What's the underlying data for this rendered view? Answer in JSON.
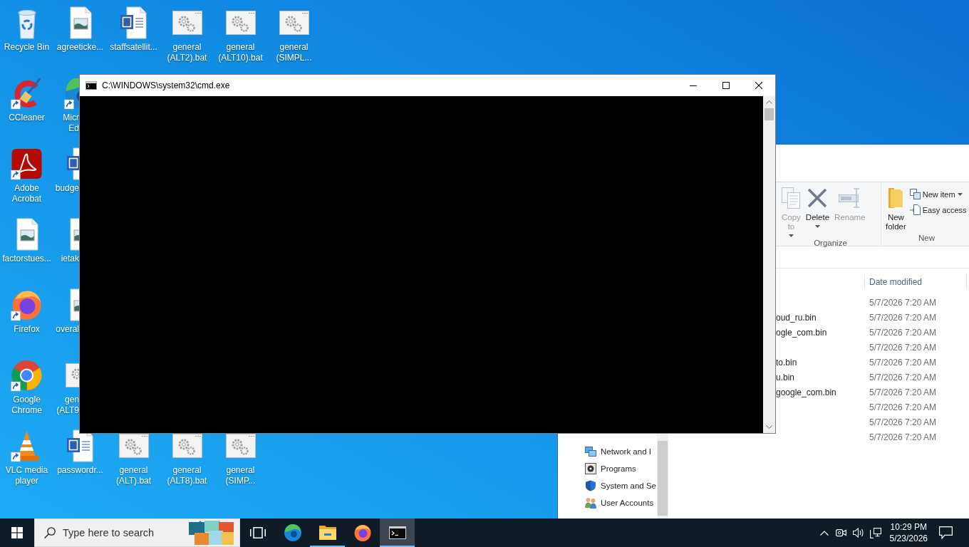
{
  "desktop": {
    "icon_columns": [
      [
        {
          "label": "Recycle Bin",
          "kind": "recycle",
          "shortcut": false,
          "covered": false
        },
        {
          "label": "CCleaner",
          "kind": "ccleaner",
          "shortcut": true,
          "covered": false
        },
        {
          "label": "Adobe Acrobat",
          "kind": "acrobat",
          "shortcut": true,
          "covered": false
        },
        {
          "label": "factorstues...",
          "kind": "image",
          "shortcut": false,
          "covered": false
        },
        {
          "label": "Firefox",
          "kind": "firefox",
          "shortcut": true,
          "covered": false
        },
        {
          "label": "Google Chrome",
          "kind": "chrome",
          "shortcut": true,
          "covered": false
        },
        {
          "label": "VLC media player",
          "kind": "vlc",
          "shortcut": true,
          "covered": false
        }
      ],
      [
        {
          "label": "agreeticke...",
          "kind": "image",
          "shortcut": false,
          "covered": false
        },
        {
          "label": "Micr Ed",
          "kind": "edge",
          "shortcut": true,
          "covered": true
        },
        {
          "label": "budge",
          "kind": "word",
          "shortcut": false,
          "covered": true
        },
        {
          "label": "ietak",
          "kind": "image",
          "shortcut": false,
          "covered": true
        },
        {
          "label": "overal",
          "kind": "image",
          "shortcut": false,
          "covered": true
        },
        {
          "label": "gen (ALT9",
          "kind": "bat",
          "shortcut": false,
          "covered": true
        },
        {
          "label": "passwordr...",
          "kind": "word",
          "shortcut": false,
          "covered": false
        }
      ],
      [
        {
          "label": "staffsatellit...",
          "kind": "word",
          "shortcut": false,
          "covered": false
        },
        {
          "label": "general (ALT).bat",
          "kind": "bat",
          "shortcut": false,
          "covered": false
        }
      ],
      [
        {
          "label": "general (ALT2).bat",
          "kind": "bat",
          "shortcut": false,
          "covered": false
        },
        {
          "label": "general (ALT8).bat",
          "kind": "bat",
          "shortcut": false,
          "covered": false
        }
      ],
      [
        {
          "label": "general (ALT10).bat",
          "kind": "bat",
          "shortcut": false,
          "covered": false
        },
        {
          "label": "general (SIMP...",
          "kind": "bat",
          "shortcut": false,
          "covered": false
        }
      ],
      [
        {
          "label": "general (SIMPL...",
          "kind": "bat",
          "shortcut": false,
          "covered": false
        }
      ]
    ]
  },
  "cmd_window": {
    "title": "C:\\WINDOWS\\system32\\cmd.exe"
  },
  "explorer_window": {
    "ribbon": {
      "groups": [
        {
          "label": "Organize",
          "buttons": [
            {
              "label": "Copy to",
              "kind": "large",
              "dropdown": true,
              "disabled": true
            },
            {
              "label": "Delete",
              "kind": "large",
              "dropdown": true,
              "disabled": false
            },
            {
              "label": "Rename",
              "kind": "large",
              "dropdown": false,
              "disabled": true
            }
          ]
        },
        {
          "label": "New",
          "buttons": [
            {
              "label": "New folder",
              "kind": "large",
              "dropdown": false,
              "disabled": false
            },
            {
              "label": "New item",
              "kind": "small",
              "dropdown": true,
              "disabled": false
            },
            {
              "label": "Easy access",
              "kind": "small",
              "dropdown": false,
              "disabled": false
            }
          ]
        }
      ]
    },
    "navigation": [
      {
        "label": "Network and I",
        "kind": "network"
      },
      {
        "label": "Programs",
        "kind": "programs"
      },
      {
        "label": "System and Se",
        "kind": "security"
      },
      {
        "label": "User Accounts",
        "kind": "users"
      }
    ],
    "file_list": {
      "columns": [
        {
          "label": "Date modified"
        }
      ],
      "rows": [
        {
          "date_modified": "5/7/2026 7:20 AM"
        },
        {
          "name": "oud_ru.bin",
          "date_modified": "5/7/2026 7:20 AM"
        },
        {
          "name": "ogle_com.bin",
          "date_modified": "5/7/2026 7:20 AM"
        },
        {
          "date_modified": "5/7/2026 7:20 AM"
        },
        {
          "name": "to.bin",
          "date_modified": "5/7/2026 7:20 AM"
        },
        {
          "name": "u.bin",
          "date_modified": "5/7/2026 7:20 AM"
        },
        {
          "name": "google_com.bin",
          "date_modified": "5/7/2026 7:20 AM"
        },
        {
          "date_modified": "5/7/2026 7:20 AM"
        },
        {
          "date_modified": "5/7/2026 7:20 AM"
        },
        {
          "date_modified": "5/7/2026 7:20 AM"
        }
      ]
    }
  },
  "taskbar": {
    "search": {
      "placeholder": "Type here to search"
    },
    "apps": [
      {
        "kind": "task_view",
        "running": false,
        "selected": false
      },
      {
        "kind": "edge",
        "running": false,
        "selected": false
      },
      {
        "kind": "explorer",
        "running": true,
        "selected": false
      },
      {
        "kind": "firefox",
        "running": false,
        "selected": false
      },
      {
        "kind": "cmd",
        "running": true,
        "selected": true
      }
    ],
    "clock": {
      "time": "10:29 PM",
      "date": "5/23/2026"
    }
  }
}
